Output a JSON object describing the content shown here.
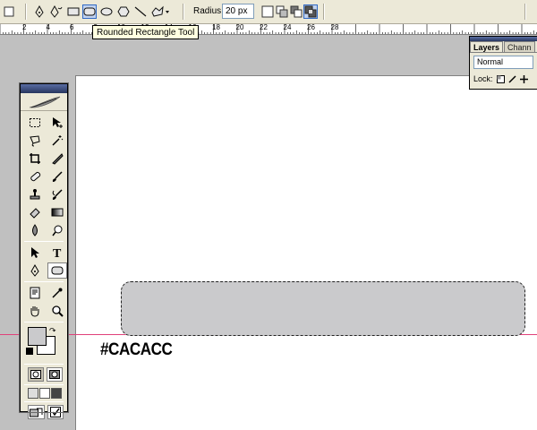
{
  "options_bar": {
    "radius_label": "Radius:",
    "radius_value": "20 px",
    "tools": [
      "pen-icon",
      "freeform-pen-icon",
      "rectangle-icon",
      "rounded-rectangle-icon",
      "ellipse-icon",
      "polygon-icon",
      "line-icon",
      "custom-shape-icon"
    ],
    "selected_tool": "rounded-rectangle-icon",
    "path_modes": [
      "add-icon",
      "subtract-icon",
      "intersect-icon",
      "exclude-icon"
    ]
  },
  "ruler": {
    "labels": [
      "2",
      "4",
      "6",
      "8",
      "10",
      "12",
      "14",
      "16",
      "18",
      "20",
      "22",
      "24",
      "26",
      "28"
    ]
  },
  "tooltip": {
    "text": "Rounded Rectangle Tool"
  },
  "canvas": {
    "fill_color": "#cacacc",
    "label": "#CACACC",
    "guide_color": "#e0417a"
  },
  "tools_palette": {
    "tools": [
      [
        "marquee-icon",
        "move-icon"
      ],
      [
        "lasso-icon",
        "magic-wand-icon"
      ],
      [
        "crop-icon",
        "slice-icon"
      ],
      [
        "healing-brush-icon",
        "brush-icon"
      ],
      [
        "clone-stamp-icon",
        "history-brush-icon"
      ],
      [
        "eraser-icon",
        "gradient-icon"
      ],
      [
        "blur-icon",
        "dodge-icon"
      ],
      [
        "path-selection-icon",
        "type-icon"
      ],
      [
        "pen-icon",
        "shape-icon"
      ],
      [
        "notes-icon",
        "eyedropper-icon"
      ],
      [
        "hand-icon",
        "zoom-icon"
      ]
    ],
    "active_tool": "shape-icon",
    "foreground_color": "#cacacc",
    "background_color": "#ffffff"
  },
  "layers_palette": {
    "tabs": [
      "Layers",
      "Chann"
    ],
    "active_tab": "Layers",
    "blend_mode": "Normal",
    "lock_label": "Lock:"
  }
}
